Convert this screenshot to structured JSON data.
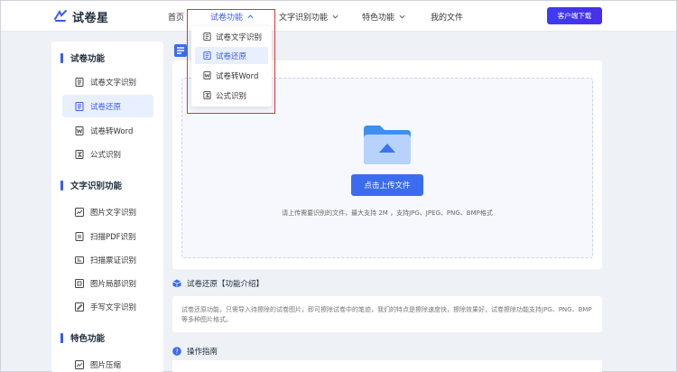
{
  "brand": {
    "name": "试卷星"
  },
  "nav": {
    "items": [
      {
        "label": "首页"
      },
      {
        "label": "试卷功能"
      },
      {
        "label": "文字识别功能"
      },
      {
        "label": "特色功能"
      },
      {
        "label": "我的文件"
      }
    ],
    "download_label": "客户端下载"
  },
  "dropdown": {
    "items": [
      {
        "label": "试卷文字识别"
      },
      {
        "label": "试卷还原"
      },
      {
        "label": "试卷转Word"
      },
      {
        "label": "公式识别"
      }
    ]
  },
  "sidebar": {
    "groups": [
      {
        "title": "试卷功能",
        "items": [
          {
            "label": "试卷文字识别"
          },
          {
            "label": "试卷还原"
          },
          {
            "label": "试卷转Word"
          },
          {
            "label": "公式识别"
          }
        ]
      },
      {
        "title": "文字识别功能",
        "items": [
          {
            "label": "图片文字识别"
          },
          {
            "label": "扫描PDF识别"
          },
          {
            "label": "扫描票证识别"
          },
          {
            "label": "图片局部识别"
          },
          {
            "label": "手写文字识别"
          }
        ]
      },
      {
        "title": "特色功能",
        "items": [
          {
            "label": "图片压缩"
          }
        ]
      }
    ]
  },
  "upload": {
    "button_label": "点击上传文件",
    "hint": "请上传需要识别的文件，最大支持 2M ，支持JPG、JPEG、PNG、BMP格式"
  },
  "intro": {
    "title": "试卷还原【功能介绍】",
    "body": "试卷还原功能，只需导入待擦除的试卷图片，即可擦除试卷中的笔迹，我们的特点是擦除速度快，擦除效果好，试卷擦除功能支持JPG、PNG、BMP等多种图片格式。"
  },
  "guide": {
    "title": "操作指南"
  },
  "colors": {
    "accent": "#3a5bf0",
    "button": "#3b6cf0",
    "download": "#3d3cf5",
    "highlight": "#e03535"
  }
}
